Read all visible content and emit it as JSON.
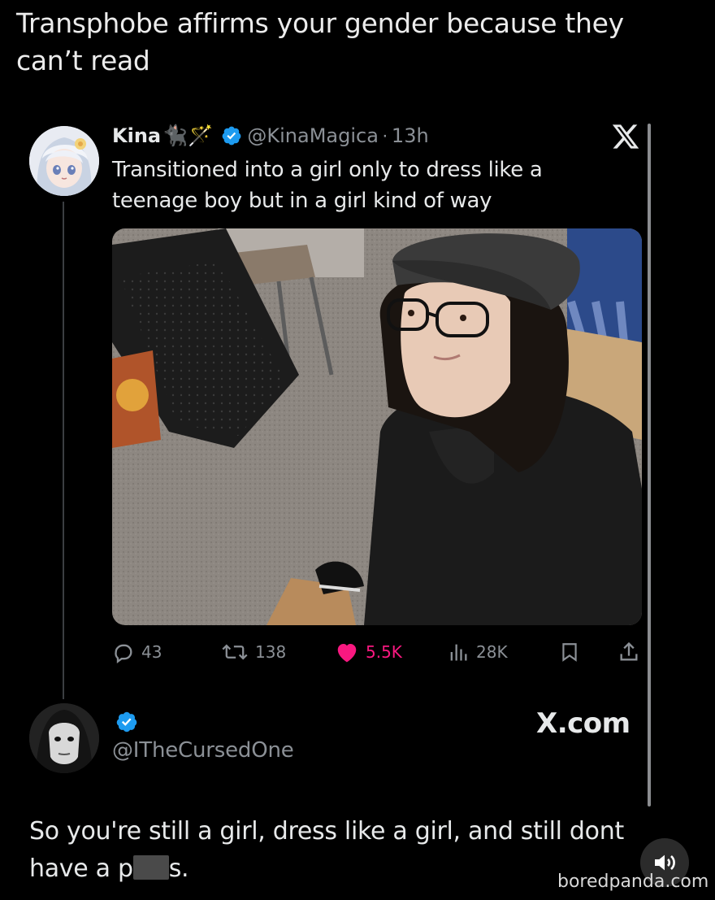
{
  "caption": "Transphobe affirms your gender because they can’t read",
  "tweet": {
    "display_name": "Kina",
    "name_emojis": "🐈‍⬛🪄",
    "handle": "@KinaMagica",
    "separator": "·",
    "time": "13h",
    "text": "Transitioned into a girl only to dress like a teenage boy but in a girl kind of way",
    "stats": {
      "replies": "43",
      "reposts": "138",
      "likes": "5.5K",
      "views": "28K"
    }
  },
  "reply": {
    "handle": "@ITheCursedOne",
    "site": "X.com",
    "text_part1": "So you're still a girl, dress like a girl, and still dont have a p",
    "text_part2": "s."
  },
  "watermark": "boredpanda.com",
  "colors": {
    "background": "#000000",
    "text": "#e7e9ea",
    "muted": "#8b9096",
    "verified": "#1d9bf0",
    "like": "#f91880"
  },
  "icons": {
    "reply": "speech-bubble-icon",
    "repost": "repost-arrows-icon",
    "like": "heart-icon",
    "views": "bar-chart-icon",
    "bookmark": "bookmark-icon",
    "share": "share-icon",
    "sound": "speaker-icon"
  }
}
